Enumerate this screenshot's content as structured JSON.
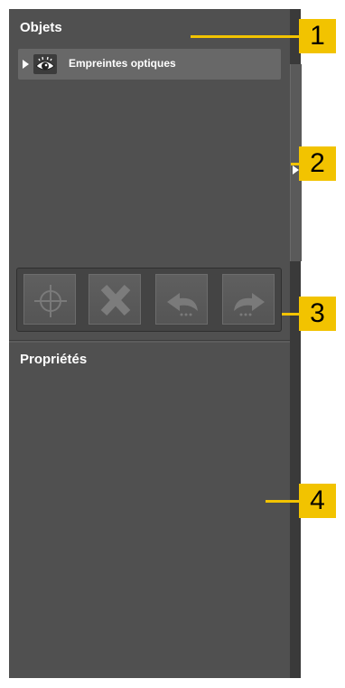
{
  "objects_panel": {
    "title": "Objets",
    "tree_item": {
      "label": "Empreintes optiques",
      "icon": "eye-icon",
      "expanded": false
    }
  },
  "toolbar": {
    "buttons": [
      {
        "name": "focus-button",
        "icon": "crosshair-icon",
        "enabled": false
      },
      {
        "name": "delete-button",
        "icon": "x-icon",
        "enabled": false
      },
      {
        "name": "undo-button",
        "icon": "undo-arrow-icon",
        "enabled": false
      },
      {
        "name": "redo-button",
        "icon": "redo-arrow-icon",
        "enabled": false
      }
    ]
  },
  "properties_panel": {
    "title": "Propriétés"
  },
  "callouts": [
    "1",
    "2",
    "3",
    "4"
  ],
  "colors": {
    "panel": "#505050",
    "accent": "#f2c300",
    "text": "#ffffff"
  }
}
